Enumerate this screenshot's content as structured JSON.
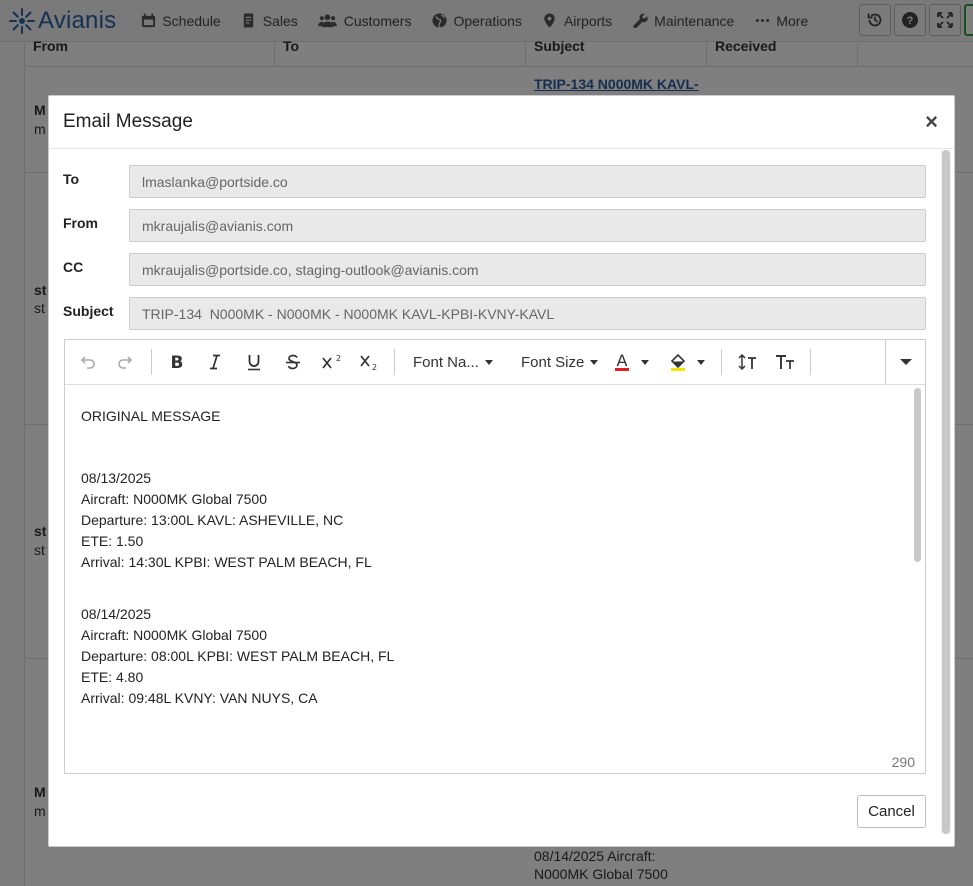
{
  "app": {
    "name": "Avianis"
  },
  "nav": {
    "items": [
      {
        "label": "Schedule",
        "icon": "calendar-icon"
      },
      {
        "label": "Sales",
        "icon": "bill-icon"
      },
      {
        "label": "Customers",
        "icon": "users-icon"
      },
      {
        "label": "Operations",
        "icon": "globe-icon"
      },
      {
        "label": "Airports",
        "icon": "map-pin-icon"
      },
      {
        "label": "Maintenance",
        "icon": "wrench-icon"
      },
      {
        "label": "More",
        "icon": "ellipsis-icon"
      }
    ],
    "right_buttons": [
      "history-icon",
      "help-icon",
      "fullscreen-icon"
    ]
  },
  "background_table": {
    "headers": [
      "From",
      "To",
      "Subject",
      "Received"
    ],
    "subject_link": "TRIP-134 N000MK KAVL-",
    "bottom_text_line1": "08/14/2025 Aircraft:",
    "bottom_text_line2": "N000MK Global 7500",
    "row_letters": [
      [
        "M",
        "m"
      ],
      [
        "st",
        "st"
      ],
      [
        "st",
        "st"
      ],
      [
        "M",
        "m"
      ]
    ]
  },
  "modal": {
    "title": "Email Message",
    "close": "×",
    "fields": {
      "to_label": "To",
      "to_value": "lmaslanka@portside.co",
      "from_label": "From",
      "from_value": "mkraujalis@avianis.com",
      "cc_label": "CC",
      "cc_value": "mkraujalis@portside.co, staging-outlook@avianis.com",
      "subject_label": "Subject",
      "subject_value": "TRIP-134  N000MK - N000MK - N000MK KAVL-KPBI-KVNY-KAVL"
    },
    "toolbar": {
      "font_name": "Font Na...",
      "font_size": "Font Size",
      "text_color": "#e02020",
      "highlight_color": "#f5e400"
    },
    "body": {
      "heading": "ORIGINAL MESSAGE",
      "legs": [
        {
          "date": "08/13/2025",
          "aircraft": "Aircraft: N000MK Global 7500",
          "departure": "Departure: 13:00L KAVL: ASHEVILLE, NC",
          "ete": "ETE: 1.50",
          "arrival": "Arrival: 14:30L KPBI: WEST PALM BEACH, FL"
        },
        {
          "date": "08/14/2025",
          "aircraft": "Aircraft: N000MK Global 7500",
          "departure": "Departure: 08:00L KPBI: WEST PALM BEACH, FL",
          "ete": "ETE: 4.80",
          "arrival": "Arrival: 09:48L KVNY: VAN NUYS, CA"
        }
      ]
    },
    "char_count": "290",
    "cancel_label": "Cancel"
  }
}
